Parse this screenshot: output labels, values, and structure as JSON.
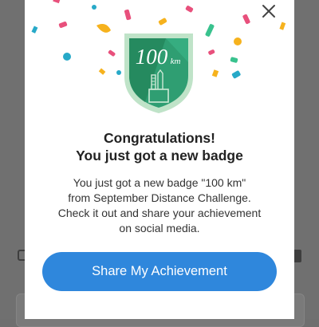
{
  "modal": {
    "badge": {
      "icon": "ruler-pencil-cup-icon",
      "distance_value": "100",
      "distance_unit": "km"
    },
    "title_line1": "Congratulations!",
    "title_line2": "You just got a new badge",
    "body_lines": [
      "You just got a new badge \"100 km\"",
      "from September Distance Challenge.",
      "Check it out and share your achievement",
      "on social media."
    ],
    "share_button_label": "Share My Achievement",
    "close_icon": "close-icon"
  },
  "colors": {
    "accent": "#2f87dc",
    "badge_green": "#2f9e72",
    "confetti": [
      "#e8507c",
      "#27a9c8",
      "#f6b21d",
      "#39c28e"
    ]
  }
}
